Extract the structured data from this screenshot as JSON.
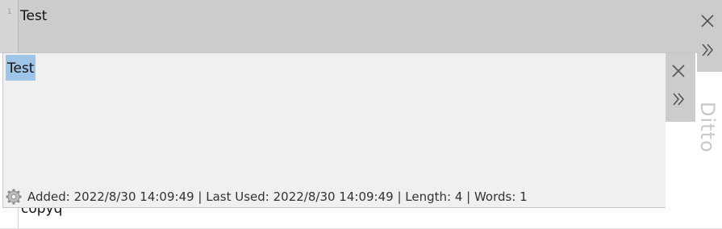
{
  "back": {
    "line_number": "1",
    "title": "Test",
    "lower_text": "copyq",
    "side_label": "Ditto"
  },
  "overlay": {
    "clip_text": "Test",
    "status": "Added: 2022/8/30 14:09:49 | Last Used: 2022/8/30 14:09:49 | Length: 4 | Words: 1"
  },
  "icons": {
    "back_close": "close-icon",
    "back_expand": "double-chevron-right-icon",
    "overlay_close": "close-icon",
    "overlay_expand": "double-chevron-right-icon",
    "settings": "gear-icon"
  },
  "colors": {
    "header_bg": "#cccccc",
    "popup_bg": "#f0f0f0",
    "selection": "#9ec5e8"
  }
}
